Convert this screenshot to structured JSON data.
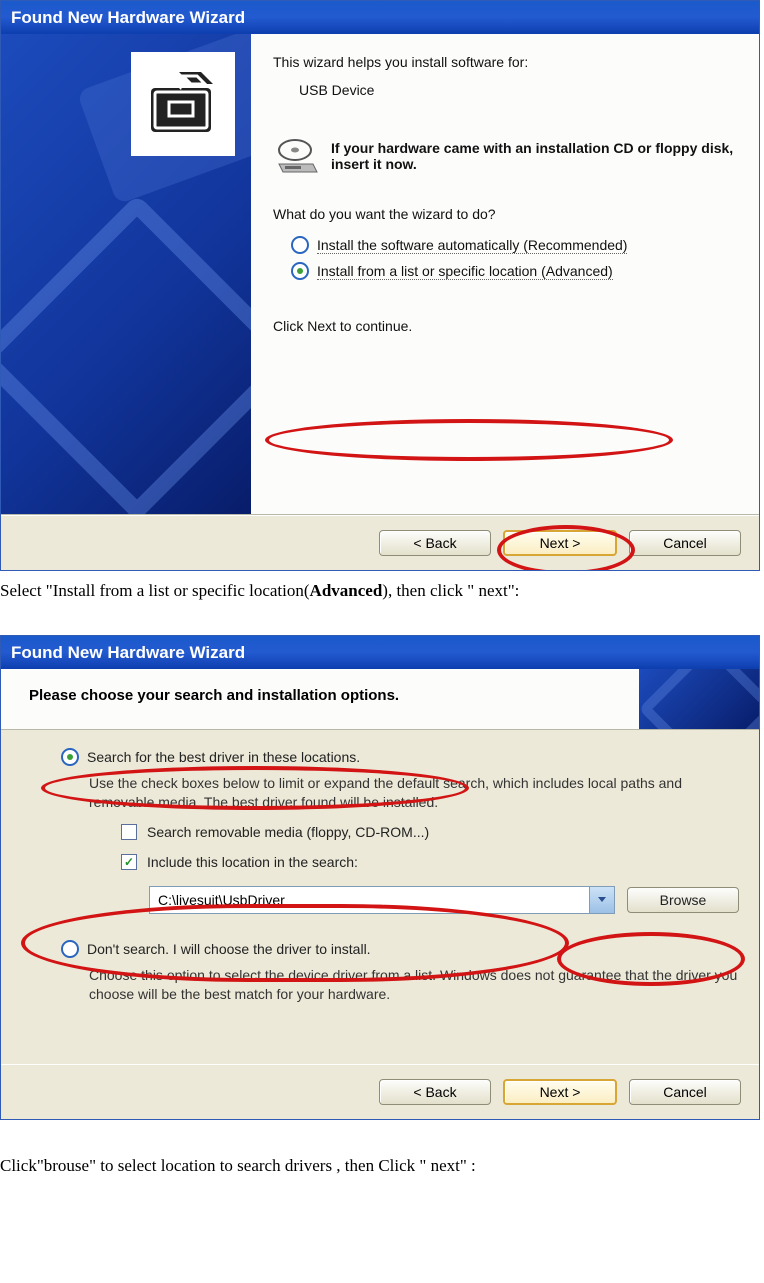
{
  "dialog1": {
    "title": "Found New Hardware Wizard",
    "intro_text": "This wizard helps you install software for:",
    "device_name": "USB Device",
    "insert_cd_text": "If your hardware came with an installation CD or floppy disk, insert it now.",
    "question": "What do you want the wizard to do?",
    "option_auto": "Install the software automatically (Recommended)",
    "option_advanced": "Install from a list or specific location (Advanced)",
    "click_next": "Click Next to continue.",
    "btn_back": "< Back",
    "btn_next": "Next >",
    "btn_cancel": "Cancel"
  },
  "caption1_a": "Select \"Install from a list or specific location(",
  "caption1_b": "Advanced",
  "caption1_c": "), then click \" next\":",
  "dialog2": {
    "title": "Found New Hardware Wizard",
    "heading": "Please choose your search and installation options.",
    "opt_search": "Search for the best driver in these locations.",
    "search_sub": "Use the check boxes below to limit or expand the default search, which includes local paths and removable media. The best driver found will be installed.",
    "chk_removable": "Search removable media (floppy, CD-ROM...)",
    "chk_include": "Include this location in the search:",
    "path_value": "C:\\livesuit\\UsbDriver",
    "browse": "Browse",
    "opt_dont": "Don't search. I will choose the driver to install.",
    "dont_sub": "Choose this option to select the device driver from a list.  Windows does not guarantee that the driver you choose will be the best match for your hardware.",
    "btn_back": "< Back",
    "btn_next": "Next >",
    "btn_cancel": "Cancel"
  },
  "caption2": "Click\"brouse\" to select location to search drivers , then Click \" next\" :"
}
